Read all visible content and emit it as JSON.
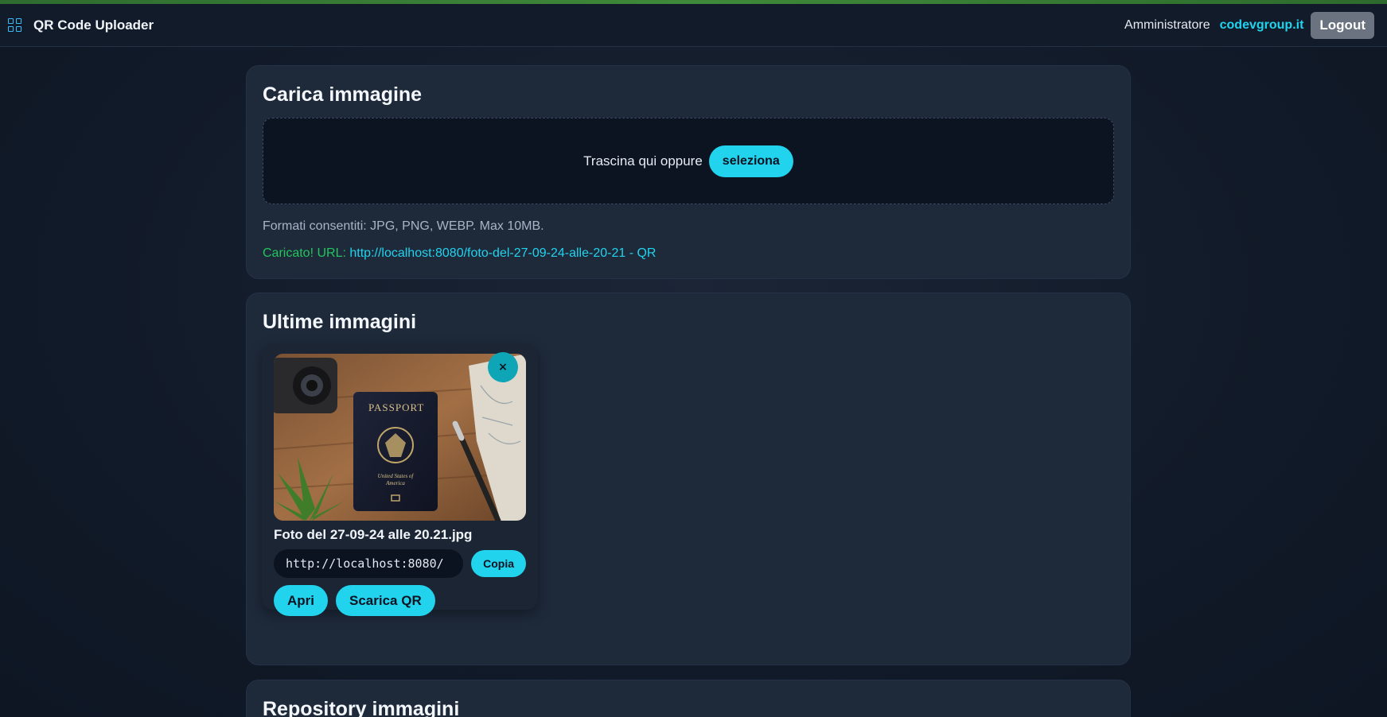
{
  "navbar": {
    "brand_icon": "grid-icon",
    "title": "QR Code Uploader",
    "user": "Amministratore",
    "org": "codevgroup.it",
    "logout_label": "Logout"
  },
  "upload": {
    "title": "Carica immagine",
    "drop_text": "Trascina qui oppure",
    "select_label": "seleziona",
    "formats": "Formati consentiti: JPG, PNG, WEBP. Max 10MB.",
    "success_label": "Caricato! URL:",
    "success_url": "http://localhost:8080/foto-del-27-09-24-alle-20-21 - QR"
  },
  "recent": {
    "title": "Ultime immagini",
    "items": [
      {
        "file_name": "Foto del 27-09-24 alle 20.21.jpg",
        "url_value": "http://localhost:8080/",
        "copy_label": "Copia",
        "open_label": "Apri",
        "download_qr_label": "Scarica QR",
        "close_label": "×",
        "image_text": "PASSPORT",
        "image_subtext": "United States of America"
      }
    ]
  },
  "repository": {
    "title": "Repository immagini"
  },
  "colors": {
    "accent": "#22d3ee",
    "success": "#22c55e",
    "card_bg": "#1e293a",
    "page_bg": "#111a28"
  }
}
